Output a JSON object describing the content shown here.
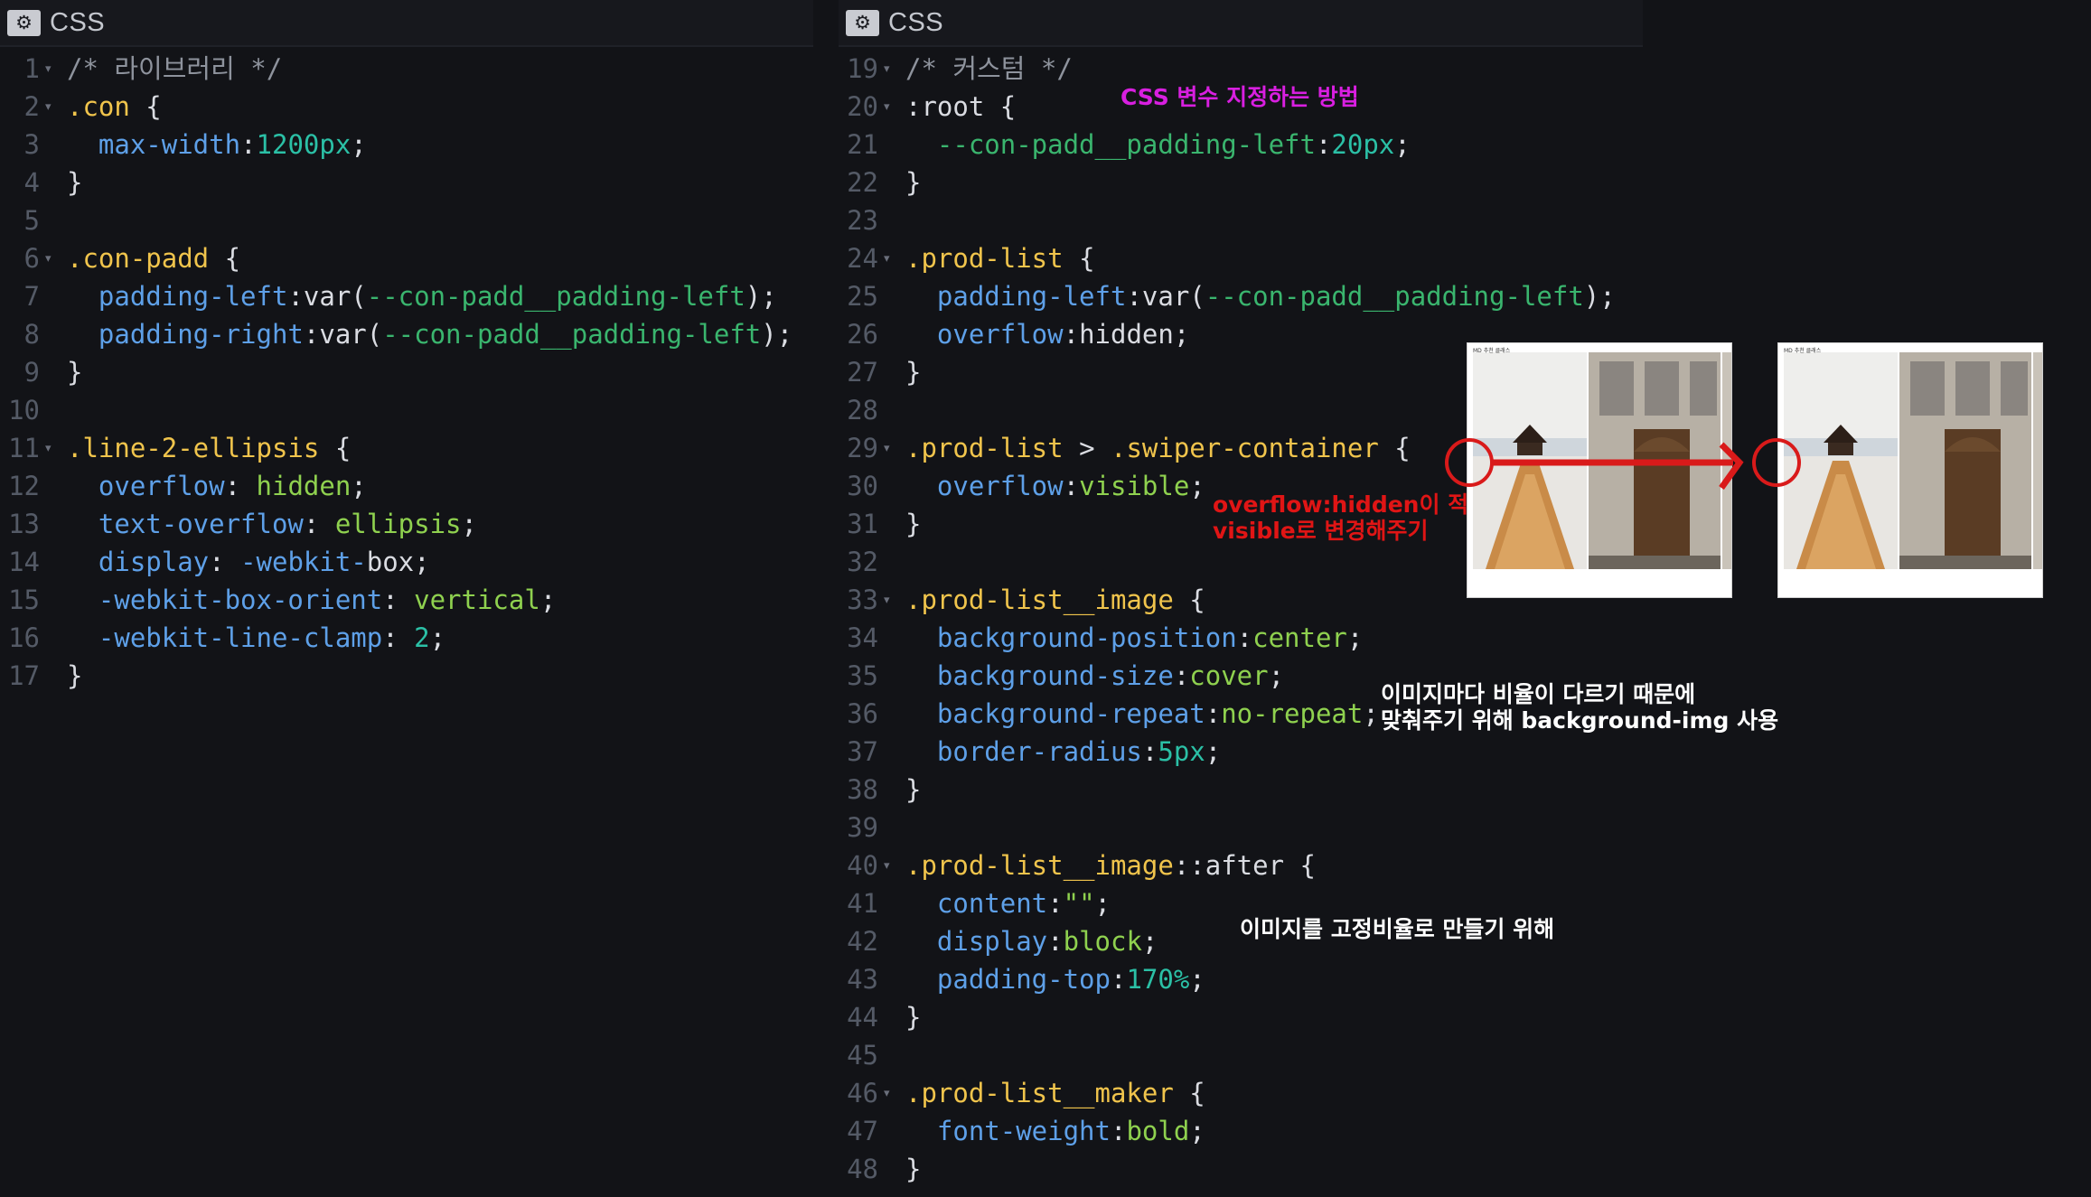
{
  "left_pane": {
    "title": "CSS",
    "gear_glyph": "⚙",
    "lines": [
      {
        "n": "1",
        "fold": true,
        "tokens": [
          [
            "comment",
            "/* 라이브러리 */"
          ]
        ]
      },
      {
        "n": "2",
        "fold": true,
        "tokens": [
          [
            "sel",
            ".con"
          ],
          [
            "punc",
            " {"
          ]
        ]
      },
      {
        "n": "3",
        "fold": false,
        "tokens": [
          [
            "punc",
            "  "
          ],
          [
            "prop",
            "max-width"
          ],
          [
            "punc",
            ":"
          ],
          [
            "num",
            "1200px"
          ],
          [
            "punc",
            ";"
          ]
        ]
      },
      {
        "n": "4",
        "fold": false,
        "tokens": [
          [
            "punc",
            "}"
          ]
        ]
      },
      {
        "n": "5",
        "fold": false,
        "tokens": []
      },
      {
        "n": "6",
        "fold": true,
        "tokens": [
          [
            "sel",
            ".con-padd"
          ],
          [
            "punc",
            " {"
          ]
        ]
      },
      {
        "n": "7",
        "fold": false,
        "tokens": [
          [
            "punc",
            "  "
          ],
          [
            "prop",
            "padding-left"
          ],
          [
            "punc",
            ":var("
          ],
          [
            "var",
            "--con-padd__padding-left"
          ],
          [
            "punc",
            ");"
          ]
        ]
      },
      {
        "n": "8",
        "fold": false,
        "tokens": [
          [
            "punc",
            "  "
          ],
          [
            "prop",
            "padding-right"
          ],
          [
            "punc",
            ":var("
          ],
          [
            "var",
            "--con-padd__padding-left"
          ],
          [
            "punc",
            ");"
          ]
        ]
      },
      {
        "n": "9",
        "fold": false,
        "tokens": [
          [
            "punc",
            "}"
          ]
        ]
      },
      {
        "n": "10",
        "fold": false,
        "tokens": []
      },
      {
        "n": "11",
        "fold": true,
        "tokens": [
          [
            "sel",
            ".line-2-ellipsis"
          ],
          [
            "punc",
            " {"
          ]
        ]
      },
      {
        "n": "12",
        "fold": false,
        "tokens": [
          [
            "punc",
            "  "
          ],
          [
            "prop",
            "overflow"
          ],
          [
            "punc",
            ": "
          ],
          [
            "val",
            "hidden"
          ],
          [
            "punc",
            ";"
          ]
        ]
      },
      {
        "n": "13",
        "fold": false,
        "tokens": [
          [
            "punc",
            "  "
          ],
          [
            "prop",
            "text-overflow"
          ],
          [
            "punc",
            ": "
          ],
          [
            "val",
            "ellipsis"
          ],
          [
            "punc",
            ";"
          ]
        ]
      },
      {
        "n": "14",
        "fold": false,
        "tokens": [
          [
            "punc",
            "  "
          ],
          [
            "prop",
            "display"
          ],
          [
            "punc",
            ": "
          ],
          [
            "prop",
            "-webkit-"
          ],
          [
            "punc",
            "box;"
          ]
        ]
      },
      {
        "n": "15",
        "fold": false,
        "tokens": [
          [
            "punc",
            "  "
          ],
          [
            "prop",
            "-webkit-box-orient"
          ],
          [
            "punc",
            ": "
          ],
          [
            "val",
            "vertical"
          ],
          [
            "punc",
            ";"
          ]
        ]
      },
      {
        "n": "16",
        "fold": false,
        "tokens": [
          [
            "punc",
            "  "
          ],
          [
            "prop",
            "-webkit-line-clamp"
          ],
          [
            "punc",
            ": "
          ],
          [
            "num",
            "2"
          ],
          [
            "punc",
            ";"
          ]
        ]
      },
      {
        "n": "17",
        "fold": false,
        "tokens": [
          [
            "punc",
            "}"
          ]
        ]
      }
    ]
  },
  "right_pane": {
    "title": "CSS",
    "gear_glyph": "⚙",
    "lines": [
      {
        "n": "19",
        "fold": true,
        "tokens": [
          [
            "comment",
            "/* 커스텀 */"
          ]
        ]
      },
      {
        "n": "20",
        "fold": true,
        "tokens": [
          [
            "punc",
            ":root {"
          ]
        ]
      },
      {
        "n": "21",
        "fold": false,
        "tokens": [
          [
            "punc",
            "  "
          ],
          [
            "var",
            "--con-padd__padding-left"
          ],
          [
            "punc",
            ":"
          ],
          [
            "num",
            "20px"
          ],
          [
            "punc",
            ";"
          ]
        ]
      },
      {
        "n": "22",
        "fold": false,
        "tokens": [
          [
            "punc",
            "}"
          ]
        ]
      },
      {
        "n": "23",
        "fold": false,
        "tokens": []
      },
      {
        "n": "24",
        "fold": true,
        "tokens": [
          [
            "sel",
            ".prod-list"
          ],
          [
            "punc",
            " {"
          ]
        ]
      },
      {
        "n": "25",
        "fold": false,
        "tokens": [
          [
            "punc",
            "  "
          ],
          [
            "prop",
            "padding-left"
          ],
          [
            "punc",
            ":var("
          ],
          [
            "var",
            "--con-padd__padding-left"
          ],
          [
            "punc",
            ");"
          ]
        ]
      },
      {
        "n": "26",
        "fold": false,
        "tokens": [
          [
            "punc",
            "  "
          ],
          [
            "prop",
            "overflow"
          ],
          [
            "punc",
            ":"
          ],
          [
            "punc",
            "hidden;"
          ]
        ]
      },
      {
        "n": "27",
        "fold": false,
        "tokens": [
          [
            "punc",
            "}"
          ]
        ]
      },
      {
        "n": "28",
        "fold": false,
        "tokens": []
      },
      {
        "n": "29",
        "fold": true,
        "tokens": [
          [
            "sel",
            ".prod-list"
          ],
          [
            "punc",
            " > "
          ],
          [
            "sel",
            ".swiper-container"
          ],
          [
            "punc",
            " {"
          ]
        ]
      },
      {
        "n": "30",
        "fold": false,
        "tokens": [
          [
            "punc",
            "  "
          ],
          [
            "prop",
            "overflow"
          ],
          [
            "punc",
            ":"
          ],
          [
            "val",
            "visible"
          ],
          [
            "punc",
            ";"
          ]
        ]
      },
      {
        "n": "31",
        "fold": false,
        "tokens": [
          [
            "punc",
            "}"
          ]
        ]
      },
      {
        "n": "32",
        "fold": false,
        "tokens": []
      },
      {
        "n": "33",
        "fold": true,
        "tokens": [
          [
            "sel",
            ".prod-list__image"
          ],
          [
            "punc",
            " {"
          ]
        ]
      },
      {
        "n": "34",
        "fold": false,
        "tokens": [
          [
            "punc",
            "  "
          ],
          [
            "prop",
            "background-position"
          ],
          [
            "punc",
            ":"
          ],
          [
            "val",
            "center"
          ],
          [
            "punc",
            ";"
          ]
        ]
      },
      {
        "n": "35",
        "fold": false,
        "tokens": [
          [
            "punc",
            "  "
          ],
          [
            "prop",
            "background-size"
          ],
          [
            "punc",
            ":"
          ],
          [
            "val",
            "cover"
          ],
          [
            "punc",
            ";"
          ]
        ]
      },
      {
        "n": "36",
        "fold": false,
        "tokens": [
          [
            "punc",
            "  "
          ],
          [
            "prop",
            "background-repeat"
          ],
          [
            "punc",
            ":"
          ],
          [
            "val",
            "no-repeat"
          ],
          [
            "punc",
            ";"
          ]
        ]
      },
      {
        "n": "37",
        "fold": false,
        "tokens": [
          [
            "punc",
            "  "
          ],
          [
            "prop",
            "border-radius"
          ],
          [
            "punc",
            ":"
          ],
          [
            "num",
            "5px"
          ],
          [
            "punc",
            ";"
          ]
        ]
      },
      {
        "n": "38",
        "fold": false,
        "tokens": [
          [
            "punc",
            "}"
          ]
        ]
      },
      {
        "n": "39",
        "fold": false,
        "tokens": []
      },
      {
        "n": "40",
        "fold": true,
        "tokens": [
          [
            "sel",
            ".prod-list__image"
          ],
          [
            "punc",
            "::after {"
          ]
        ]
      },
      {
        "n": "41",
        "fold": false,
        "tokens": [
          [
            "punc",
            "  "
          ],
          [
            "prop",
            "content"
          ],
          [
            "punc",
            ":"
          ],
          [
            "val",
            "\"\""
          ],
          [
            "punc",
            ";"
          ]
        ]
      },
      {
        "n": "42",
        "fold": false,
        "tokens": [
          [
            "punc",
            "  "
          ],
          [
            "prop",
            "display"
          ],
          [
            "punc",
            ":"
          ],
          [
            "val",
            "block"
          ],
          [
            "punc",
            ";"
          ]
        ]
      },
      {
        "n": "43",
        "fold": false,
        "tokens": [
          [
            "punc",
            "  "
          ],
          [
            "prop",
            "padding-top"
          ],
          [
            "punc",
            ":"
          ],
          [
            "num",
            "170%"
          ],
          [
            "punc",
            ";"
          ]
        ]
      },
      {
        "n": "44",
        "fold": false,
        "tokens": [
          [
            "punc",
            "}"
          ]
        ]
      },
      {
        "n": "45",
        "fold": false,
        "tokens": []
      },
      {
        "n": "46",
        "fold": true,
        "tokens": [
          [
            "sel",
            ".prod-list__maker"
          ],
          [
            "punc",
            " {"
          ]
        ]
      },
      {
        "n": "47",
        "fold": false,
        "tokens": [
          [
            "punc",
            "  "
          ],
          [
            "prop",
            "font-weight"
          ],
          [
            "punc",
            ":"
          ],
          [
            "val",
            "bold"
          ],
          [
            "punc",
            ";"
          ]
        ]
      },
      {
        "n": "48",
        "fold": false,
        "tokens": [
          [
            "punc",
            "}"
          ]
        ]
      }
    ]
  },
  "annotations": {
    "css_var": "CSS 변수 지정하는 방법",
    "overflow": "overflow:hidden이 적용되었기 때문에\nvisible로 변경해주기",
    "ratio": "이미지마다 비율이 다르기 때문에\n맞춰주기 위해 background-img 사용",
    "fixed_ratio": "이미지를 고정비율로 만들기 위해"
  },
  "demo_images": {
    "before_header": "MD 추천 클래스",
    "after_header": "MD 추천 클래스"
  },
  "colors": {
    "background": "#121317",
    "selector": "#f0c44c",
    "property": "#5ea0e8",
    "value": "#8fd14f",
    "number": "#2bc0a6",
    "variable": "#3ab56e",
    "comment": "#8e939d",
    "annotation_magenta": "#d81fe0",
    "annotation_red": "#e01515"
  }
}
